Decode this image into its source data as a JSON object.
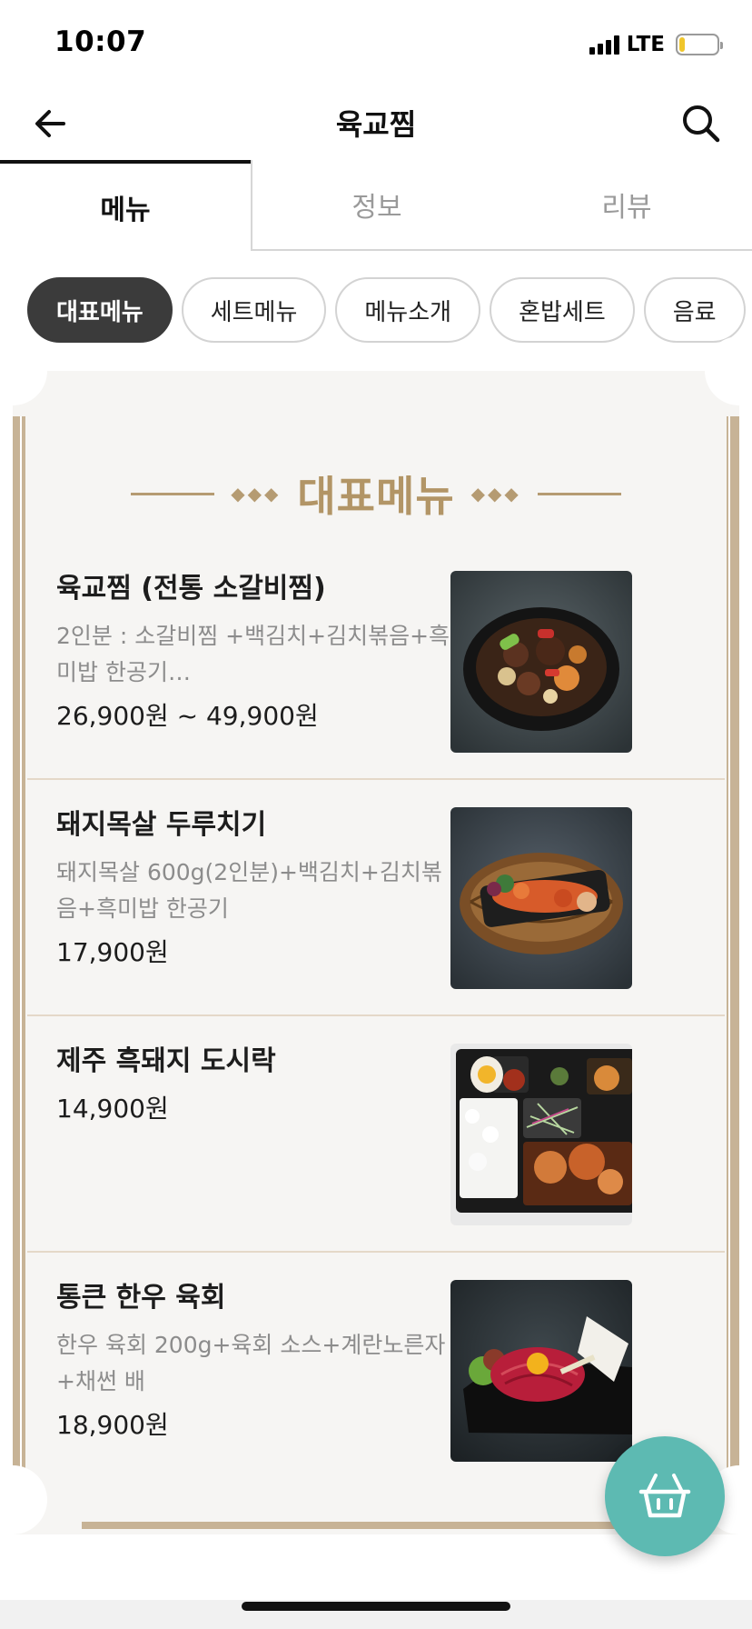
{
  "status_bar": {
    "time": "10:07",
    "network": "LTE",
    "battery_level": 0.15,
    "battery_color": "#f0c62b"
  },
  "nav": {
    "title": "육교찜",
    "back_icon": "arrow-left-icon",
    "search_icon": "search-icon"
  },
  "tabs": [
    {
      "label": "메뉴",
      "active": true
    },
    {
      "label": "정보",
      "active": false
    },
    {
      "label": "리뷰",
      "active": false
    }
  ],
  "categories": [
    {
      "label": "대표메뉴",
      "active": true
    },
    {
      "label": "세트메뉴",
      "active": false
    },
    {
      "label": "메뉴소개",
      "active": false
    },
    {
      "label": "혼밥세트",
      "active": false
    },
    {
      "label": "음료",
      "active": false
    }
  ],
  "section": {
    "title": "대표메뉴",
    "accent_color": "#b29566"
  },
  "menu_items": [
    {
      "name": "육교찜 (전통 소갈비찜)",
      "description": "2인분 : 소갈비찜 +백김치+김치볶음+흑미밥 한공기…",
      "price": "26,900원 ~ 49,900원",
      "photo": "braised-short-ribs-photo"
    },
    {
      "name": "돼지목살 두루치기",
      "description": "돼지목살 600g(2인분)+백김치+김치볶음+흑미밥 한공기",
      "price": "17,900원",
      "photo": "spicy-pork-stir-fry-photo"
    },
    {
      "name": "제주 흑돼지 도시락",
      "description": "",
      "price": "14,900원",
      "photo": "black-pork-lunchbox-photo"
    },
    {
      "name": "통큰 한우 육회",
      "description": "한우 육회 200g+육회 소스+계란노른자+채썬 배",
      "price": "18,900원",
      "photo": "beef-tartare-photo"
    }
  ],
  "cart": {
    "icon": "shopping-basket-icon",
    "color": "#5dbab2"
  }
}
